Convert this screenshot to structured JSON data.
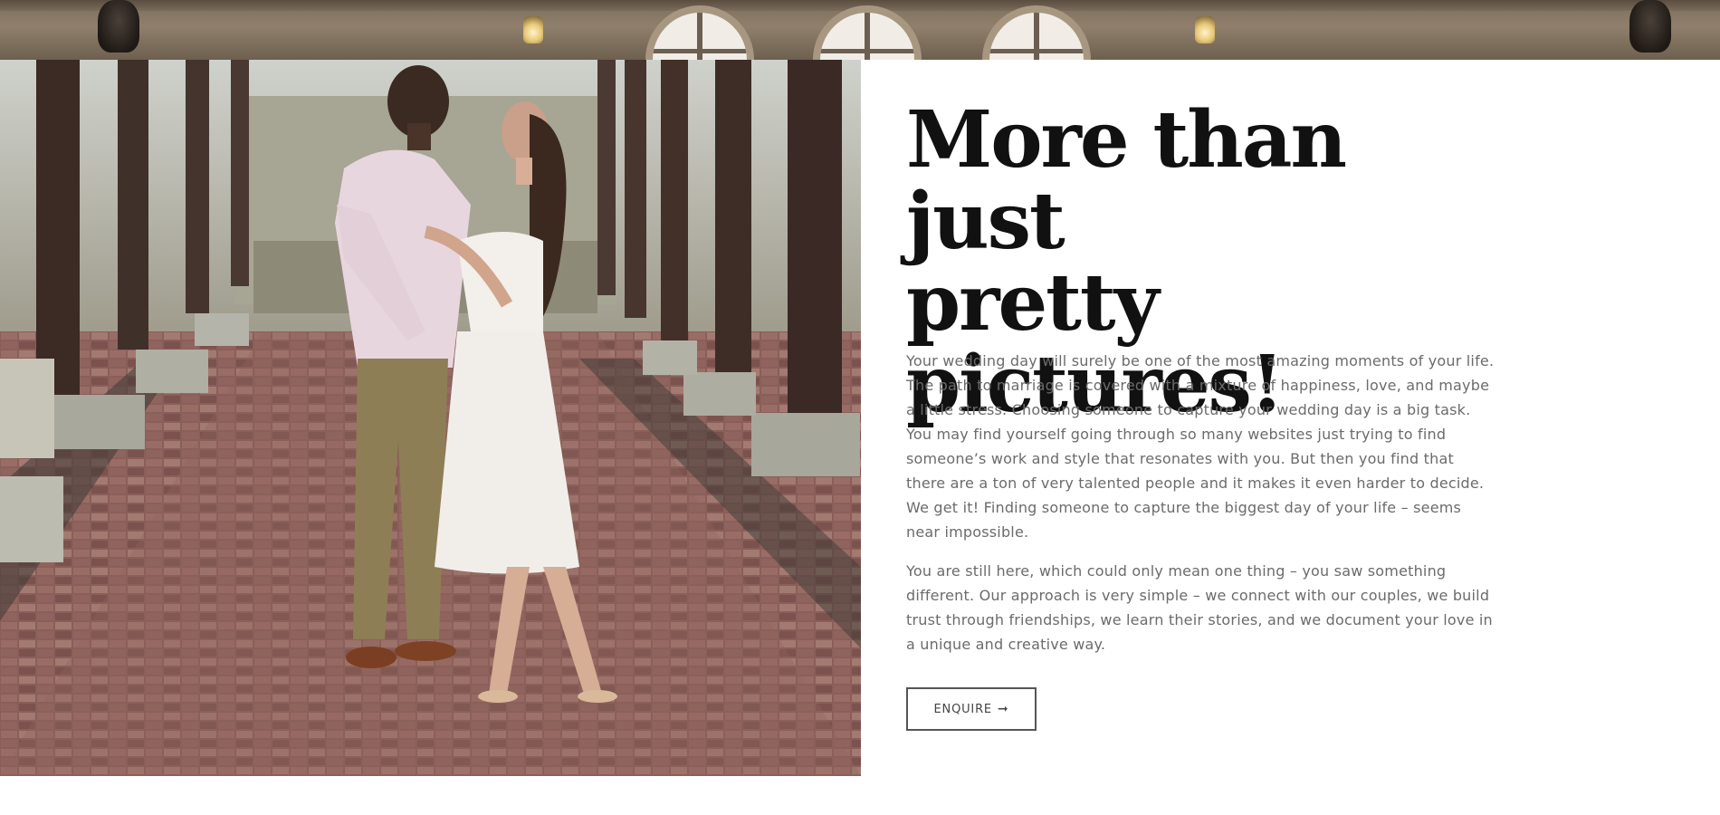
{
  "section": {
    "headline_line1": "More than just",
    "headline_line2": "pretty pictures!",
    "paragraph1": "Your wedding day will surely be one of the most amazing moments of your life. The path to marriage is covered with a mixture of happiness, love, and maybe a little stress. Choosing someone to capture your wedding day is a big task. You may find yourself going through so many websites just trying to find someone’s work and style that resonates with you. But then you find that there are a ton of very talented people and it makes it even harder to decide. We get it! Finding someone to capture the biggest day of your life – seems near impossible.",
    "paragraph2": "You are still here, which could only mean one thing – you saw something different. Our approach is very simple – we connect with our couples, we build trust through friendships, we learn their stories, and we document your love in a unique and creative way.",
    "button_label": "ENQUIRE",
    "button_icon": "arrow-right-icon",
    "button_icon_glyph": "➞"
  },
  "colors": {
    "headline": "#111111",
    "body_text": "#6b6b6b",
    "button_border": "#555555",
    "background": "#ffffff"
  }
}
